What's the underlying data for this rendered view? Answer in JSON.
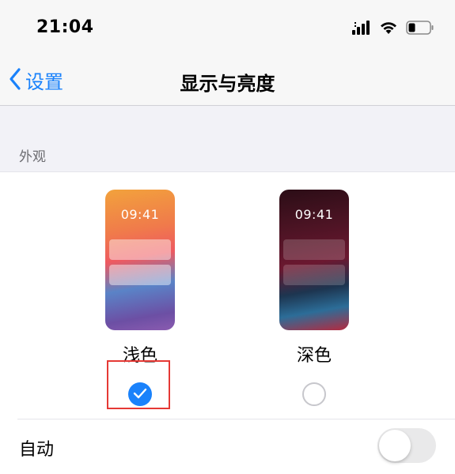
{
  "status_bar": {
    "time": "21:04",
    "icons": [
      "signal-icon",
      "wifi-icon",
      "battery-icon"
    ]
  },
  "nav": {
    "back_label": "设置",
    "title": "显示与亮度"
  },
  "appearance": {
    "section_title": "外观",
    "options": [
      {
        "label": "浅色",
        "preview_time": "09:41",
        "selected": true
      },
      {
        "label": "深色",
        "preview_time": "09:41",
        "selected": false
      }
    ]
  },
  "auto": {
    "label": "自动",
    "enabled": false
  },
  "colors": {
    "accent": "#1a82fb",
    "highlight_box": "#e53935",
    "background": "#f2f2f7"
  }
}
